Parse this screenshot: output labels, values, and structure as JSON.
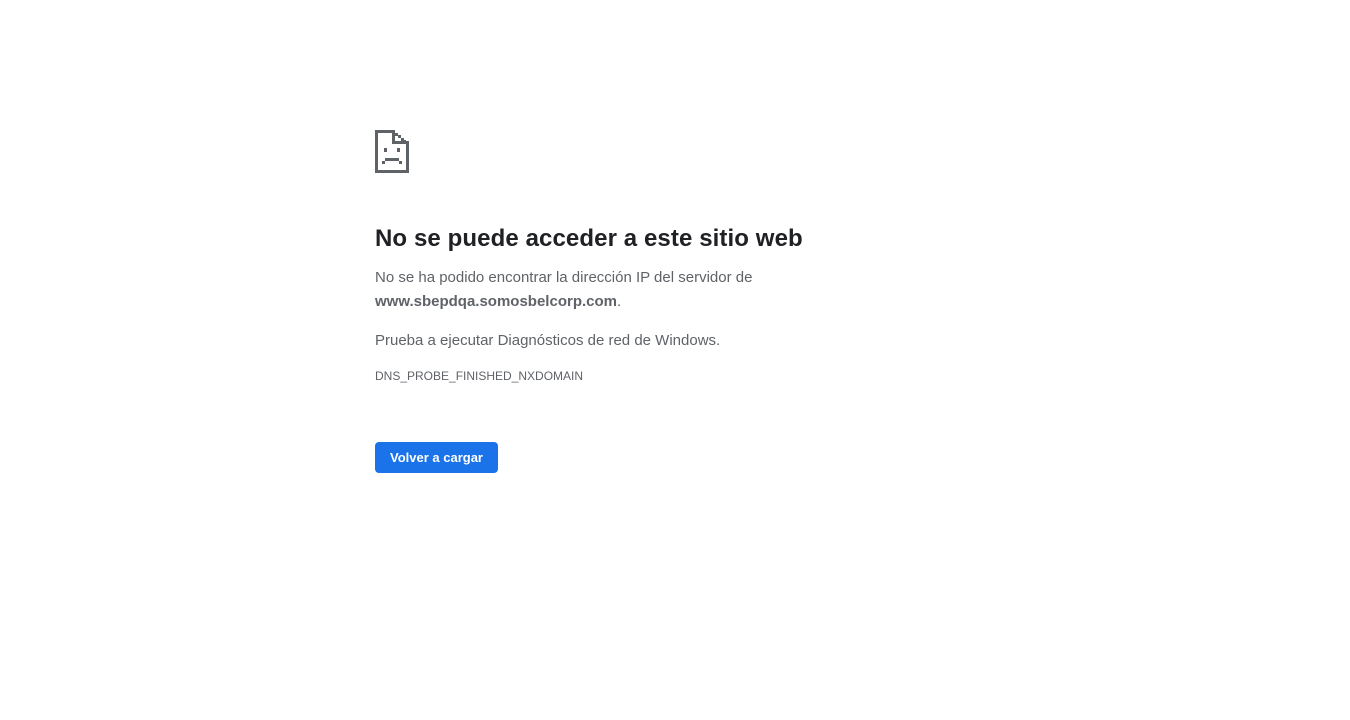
{
  "error_page": {
    "icon": "sad-document-icon",
    "heading": "No se puede acceder a este sitio web",
    "message_prefix": "No se ha podido encontrar la dirección IP del servidor de",
    "host": "www.sbepdqa.somosbelcorp.com",
    "message_suffix": ".",
    "suggestion": "Prueba a ejecutar Diagnósticos de red de Windows.",
    "error_code": "DNS_PROBE_FINISHED_NXDOMAIN",
    "reload_button_label": "Volver a cargar"
  },
  "colors": {
    "background": "#ffffff",
    "heading_text": "#202124",
    "body_text": "#5f6368",
    "button_bg": "#1a73e8",
    "button_text": "#ffffff"
  }
}
